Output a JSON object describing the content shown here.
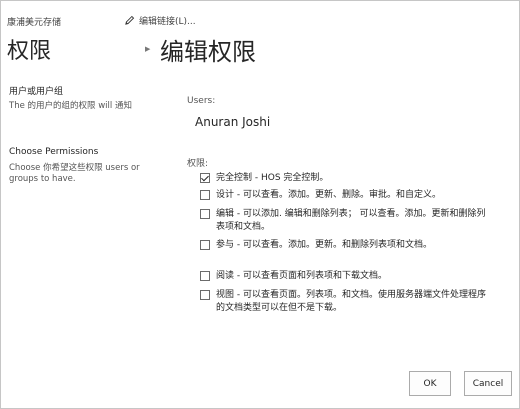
{
  "header": {
    "site_name": "康浦美元存储",
    "edit_links": "编辑链接(L)...",
    "left_title": "权限",
    "main_title": "编辑权限"
  },
  "users_section": {
    "title": "用户或用户组",
    "description": "The 的用户的组的权限 will 通知"
  },
  "permissions_section": {
    "title": "Choose Permissions",
    "description": "Choose 你希望这些权限 users or groups to have."
  },
  "form": {
    "users_label": "Users:",
    "user_value": "Anuran Joshi",
    "permissions_label": "权限:",
    "permissions": [
      {
        "label": "完全控制 - HOS 完全控制。",
        "checked": true
      },
      {
        "label": "设计 - 可以查看。添加。更新、删除。审批。和自定义。",
        "checked": false
      },
      {
        "label": "编辑 - 可以添加. 编辑和删除列表； 可以查看。添加。更新和删除列表项和文档。",
        "checked": false
      },
      {
        "label": "参与 - 可以查看。添加。更新。和删除列表项和文档。",
        "checked": false
      },
      {
        "label": "阅读 - 可以查看页面和列表项和下载文档。",
        "checked": false
      },
      {
        "label": "视图 - 可以查看页面。列表项。和文档。使用服务器端文件处理程序的文档类型可以在但不是下载。",
        "checked": false
      }
    ]
  },
  "buttons": {
    "ok": "OK",
    "cancel": "Cancel"
  }
}
